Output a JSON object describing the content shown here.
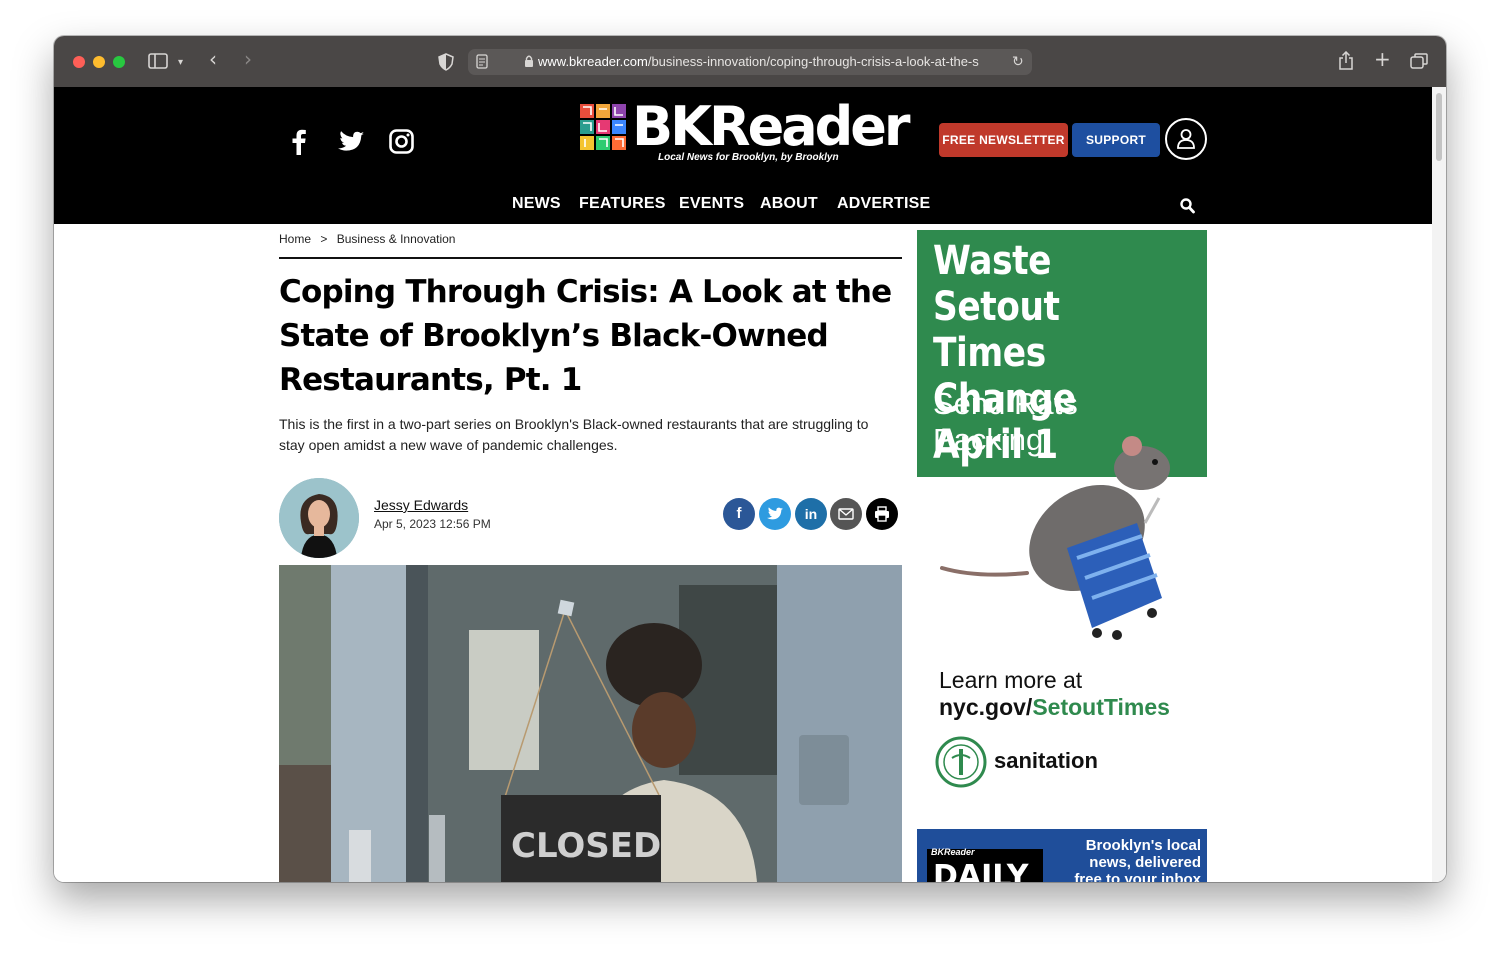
{
  "browser": {
    "url_host": "www.bkreader.com",
    "url_path": "/business-innovation/coping-through-crisis-a-look-at-the-s"
  },
  "site": {
    "logo_text": "BKReader",
    "tagline": "Local News for Brooklyn, by Brooklyn",
    "newsletter_label": "FREE NEWSLETTER",
    "support_label": "SUPPORT",
    "nav": [
      "NEWS",
      "FEATURES",
      "EVENTS",
      "ABOUT",
      "ADVERTISE"
    ],
    "colors": {
      "header_bg": "#000000",
      "newsletter_btn": "#c0392b",
      "support_btn": "#1e4fa0"
    }
  },
  "article": {
    "breadcrumb_home": "Home",
    "breadcrumb_sep": ">",
    "breadcrumb_section": "Business & Innovation",
    "headline": "Coping Through Crisis: A Look at the State of Brooklyn’s Black-Owned Restaurants, Pt. 1",
    "dek": "This is the first in a two-part series on Brooklyn's Black-owned restaurants that are struggling to stay open amidst a new wave of pandemic challenges.",
    "author": "Jessy Edwards",
    "date": "Apr 5, 2023 12:56 PM",
    "photo_sign": "CLOSED",
    "share_icons": [
      "facebook-icon",
      "twitter-icon",
      "linkedin-icon",
      "email-icon",
      "print-icon"
    ]
  },
  "ad": {
    "headline_lines": [
      "Waste Setout",
      "Times Change",
      "April 1"
    ],
    "sub_lines": [
      "Send Rats",
      "Packing!"
    ],
    "learn": "Learn more at",
    "url_prefix": "nyc.gov/",
    "url_highlight": "SetoutTimes",
    "agency": "sanitation",
    "brand_color": "#2f8a4e"
  },
  "ad2": {
    "logo": "BKReader",
    "title": "DAILY",
    "text_lines": [
      "Brooklyn's local",
      "news, delivered",
      "free to your inbox"
    ]
  }
}
